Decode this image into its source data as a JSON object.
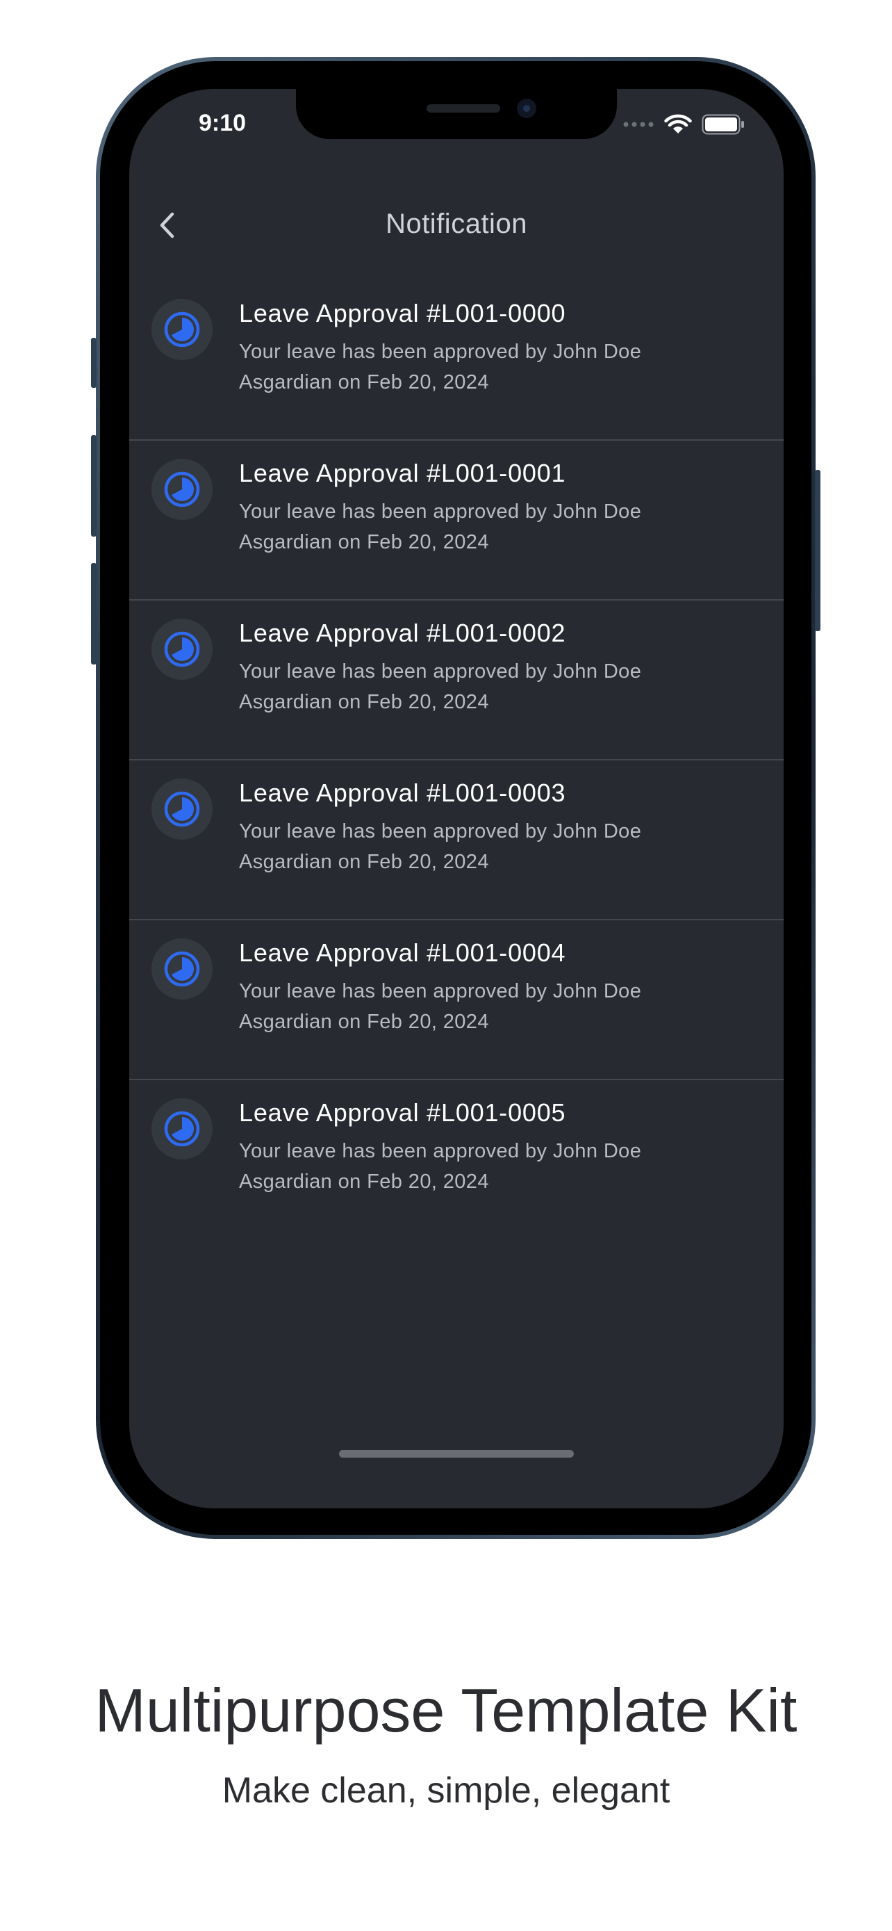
{
  "status_bar": {
    "time": "9:10"
  },
  "header": {
    "title": "Notification"
  },
  "notifications": [
    {
      "title": "Leave Approval #L001-0000",
      "body": "Your leave has been approved by John Doe Asgardian on Feb 20, 2024"
    },
    {
      "title": "Leave Approval #L001-0001",
      "body": "Your leave has been approved by John Doe Asgardian on Feb 20, 2024"
    },
    {
      "title": "Leave Approval #L001-0002",
      "body": "Your leave has been approved by John Doe Asgardian on Feb 20, 2024"
    },
    {
      "title": "Leave Approval #L001-0003",
      "body": "Your leave has been approved by John Doe Asgardian on Feb 20, 2024"
    },
    {
      "title": "Leave Approval #L001-0004",
      "body": "Your leave has been approved by John Doe Asgardian on Feb 20, 2024"
    },
    {
      "title": "Leave Approval #L001-0005",
      "body": "Your leave has been approved by John Doe Asgardian on Feb 20, 2024"
    }
  ],
  "icons": {
    "back": "chevron-left-icon",
    "notification": "clock-progress-icon",
    "signal": "signal-dots-icon",
    "wifi": "wifi-icon",
    "battery": "battery-icon"
  },
  "colors": {
    "accent": "#2f6bf0",
    "screen_bg": "#272a30"
  },
  "promo": {
    "headline": "Multipurpose Template Kit",
    "subheadline": "Make clean, simple, elegant"
  }
}
